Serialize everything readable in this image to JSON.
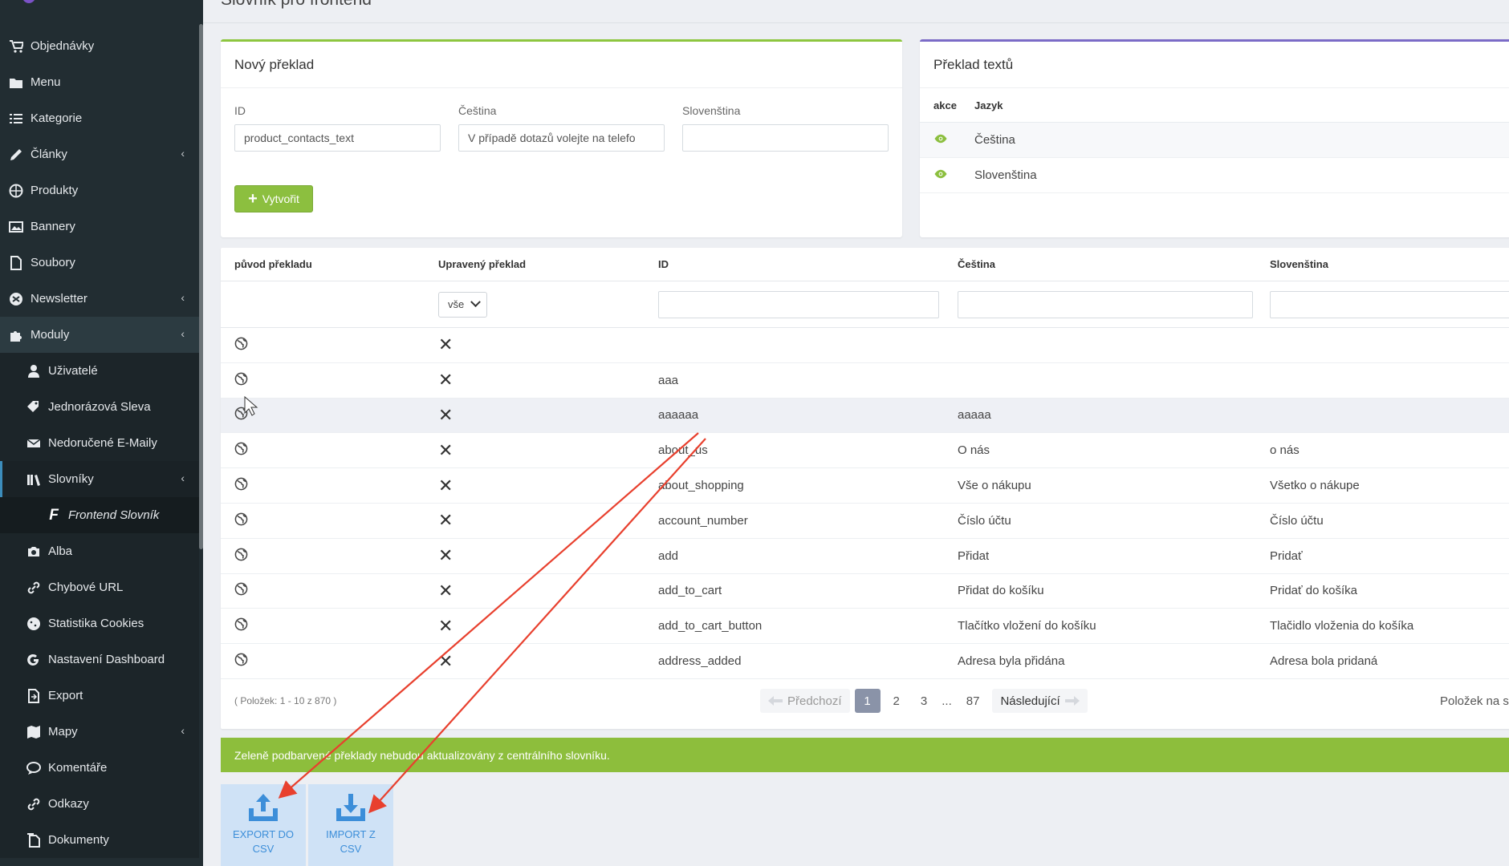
{
  "sidebar": {
    "items": [
      {
        "label": "Objednávky",
        "icon": "cart-icon"
      },
      {
        "label": "Menu",
        "icon": "folder-icon"
      },
      {
        "label": "Kategorie",
        "icon": "list-icon"
      },
      {
        "label": "Články",
        "icon": "pencil-icon",
        "has_children": true
      },
      {
        "label": "Produkty",
        "icon": "product-icon"
      },
      {
        "label": "Bannery",
        "icon": "image-icon"
      },
      {
        "label": "Soubory",
        "icon": "file-icon"
      },
      {
        "label": "Newsletter",
        "icon": "newsletter-icon",
        "has_children": true
      },
      {
        "label": "Moduly",
        "icon": "puzzle-icon",
        "has_children": true,
        "active": true
      },
      {
        "label": "Uživatelé",
        "icon": "user-icon"
      },
      {
        "label": "Jednorázová Sleva",
        "icon": "tags-icon"
      },
      {
        "label": "Nedoručené E-Maily",
        "icon": "envelope-icon"
      },
      {
        "label": "Slovníky",
        "icon": "book-icon",
        "has_children": true,
        "open": true
      },
      {
        "label": "Frontend Slovník",
        "icon": "f-icon"
      },
      {
        "label": "Alba",
        "icon": "camera-icon"
      },
      {
        "label": "Chybové URL",
        "icon": "link-icon"
      },
      {
        "label": "Statistika Cookies",
        "icon": "cookie-icon"
      },
      {
        "label": "Nastavení Dashboard",
        "icon": "g-icon"
      },
      {
        "label": "Export",
        "icon": "export-icon"
      },
      {
        "label": "Mapy",
        "icon": "map-icon",
        "has_children": true
      },
      {
        "label": "Komentáře",
        "icon": "comments-icon"
      },
      {
        "label": "Odkazy",
        "icon": "link-icon"
      },
      {
        "label": "Dokumenty",
        "icon": "documents-icon"
      }
    ],
    "chevron": "‹"
  },
  "page": {
    "title": "Slovník pro frontend"
  },
  "new_translation": {
    "title": "Nový překlad",
    "fields": [
      {
        "label": "ID",
        "value": "product_contacts_text"
      },
      {
        "label": "Čeština",
        "value": "V případě dotazů volejte na telefo"
      },
      {
        "label": "Slovenština",
        "value": ""
      }
    ],
    "create_label": "Vytvořit"
  },
  "text_translation": {
    "title": "Překlad textů",
    "headers": {
      "action": "akce",
      "language": "Jazyk"
    },
    "rows": [
      {
        "language": "Čeština"
      },
      {
        "language": "Slovenština"
      }
    ]
  },
  "table": {
    "headers": [
      "původ překladu",
      "Upravený překlad",
      "ID",
      "Čeština",
      "Slovenština"
    ],
    "filter_select": "vše",
    "rows": [
      {
        "id": "",
        "cs": "",
        "sk": ""
      },
      {
        "id": "aaa",
        "cs": "",
        "sk": ""
      },
      {
        "id": "aaaaaa",
        "cs": "aaaaa",
        "sk": ""
      },
      {
        "id": "about_us",
        "cs": "O nás",
        "sk": "o nás"
      },
      {
        "id": "about_shopping",
        "cs": "Vše o nákupu",
        "sk": "Všetko o nákupe"
      },
      {
        "id": "account_number",
        "cs": "Číslo účtu",
        "sk": "Číslo účtu"
      },
      {
        "id": "add",
        "cs": "Přidat",
        "sk": "Pridať"
      },
      {
        "id": "add_to_cart",
        "cs": "Přidat do košíku",
        "sk": "Pridať do košíka"
      },
      {
        "id": "add_to_cart_button",
        "cs": "Tlačítko vložení do košíku",
        "sk": "Tlačidlo vloženia do košíka"
      },
      {
        "id": "address_added",
        "cs": "Adresa byla přidána",
        "sk": "Adresa bola pridaná"
      }
    ],
    "count_text": "( Položek: 1 - 10 z 870 )",
    "pagination": {
      "prev": "Předchozí",
      "pages": [
        "1",
        "2",
        "3",
        "...",
        "87"
      ],
      "current": "1",
      "next": "Následující"
    },
    "per_page_label": "Položek na strá"
  },
  "note": "Zeleně podbarvené překlady nebudou aktualizovány z centrálního slovníku.",
  "csv": {
    "export_line1": "EXPORT DO",
    "export_line2": "CSV",
    "import_line1": "IMPORT Z",
    "import_line2": "CSV"
  },
  "colors": {
    "sidebar_bg": "#222d32",
    "green_accent": "#8dc63f",
    "purple_accent": "#7b6bc7",
    "annotation_arrow": "#e8402e",
    "csv_button_bg": "#cfe2f6",
    "csv_button_fg": "#3c8ed9"
  }
}
